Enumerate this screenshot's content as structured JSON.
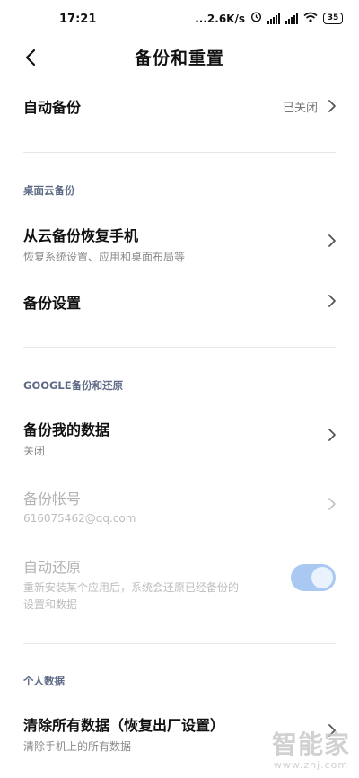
{
  "status_bar": {
    "time": "17:21",
    "net_speed": "...2.6K/s",
    "battery": "35"
  },
  "header": {
    "title": "备份和重置"
  },
  "auto_backup": {
    "label": "自动备份",
    "value": "已关闭"
  },
  "desktop_cloud": {
    "section_label": "桌面云备份",
    "restore": {
      "title": "从云备份恢复手机",
      "subtitle": "恢复系统设置、应用和桌面布局等"
    },
    "settings": {
      "title": "备份设置"
    }
  },
  "google": {
    "section_label": "GOOGLE备份和还原",
    "backup_data": {
      "title": "备份我的数据",
      "subtitle": "关闭"
    },
    "backup_account": {
      "title": "备份帐号",
      "subtitle": "616075462@qq.com"
    },
    "auto_restore": {
      "title": "自动还原",
      "subtitle_line1": "重新安装某个应用后，系统会还原已经备份的",
      "subtitle_line2": "设置和数据",
      "enabled": true
    }
  },
  "personal": {
    "section_label": "个人数据",
    "factory_reset": {
      "title": "清除所有数据（恢复出厂设置）",
      "subtitle": "清除手机上的所有数据"
    }
  },
  "watermark": {
    "logo_text": "智能家",
    "url": "www.znj.com"
  },
  "colors": {
    "section_label": "#5f6a86",
    "toggle_track": "#a9c9f2",
    "divider": "#e7e7e7"
  }
}
